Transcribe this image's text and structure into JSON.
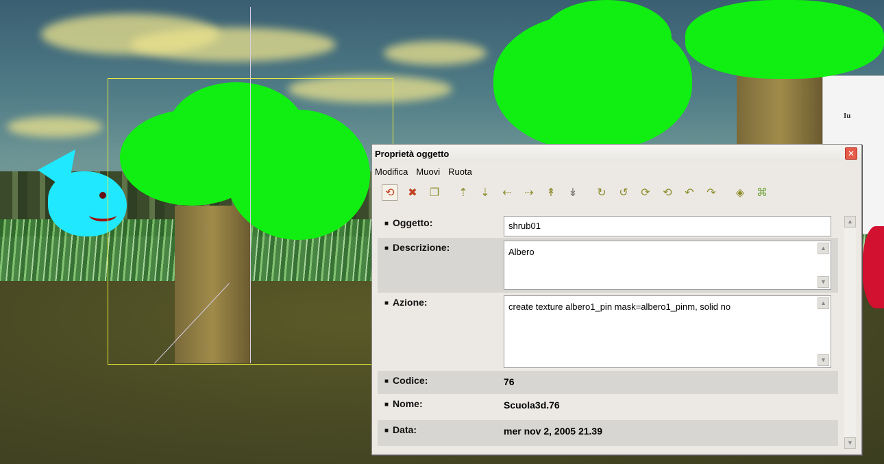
{
  "window": {
    "title": "Proprietà oggetto",
    "close_icon": "close-icon"
  },
  "menu": {
    "items": [
      {
        "label": "Modifica"
      },
      {
        "label": "Muovi"
      },
      {
        "label": "Ruota"
      }
    ]
  },
  "toolbar": {
    "icons": [
      "rotate-icon",
      "delete-icon",
      "duplicate-icon",
      "move-up-icon",
      "move-down-icon",
      "move-left-icon",
      "move-right-icon",
      "move-forward-icon",
      "move-back-icon",
      "rotate-x-icon",
      "rotate-y-icon",
      "rotate-z-icon",
      "rotate-x-neg-icon",
      "rotate-y-neg-icon",
      "rotate-z-neg-icon",
      "snap-icon",
      "grid-icon"
    ]
  },
  "properties": {
    "oggetto": {
      "label": "Oggetto:",
      "value": "shrub01"
    },
    "descrizione": {
      "label": "Descrizione:",
      "value": "Albero"
    },
    "azione": {
      "label": "Azione:",
      "value": "create  texture albero1_pin mask=albero1_pinm, solid no"
    },
    "codice": {
      "label": "Codice:",
      "value": "76"
    },
    "nome": {
      "label": "Nome:",
      "value": "Scuola3d.76"
    },
    "data": {
      "label": "Data:",
      "value": "mer nov 2, 2005 21.39"
    }
  },
  "scene": {
    "background_text": "Iu"
  },
  "colors": {
    "foliage": "#11ee11",
    "sky": "#4f7b86",
    "selection": "#eaea3a",
    "dialog_bg": "#ece9e4",
    "close_button": "#e65a4a"
  }
}
